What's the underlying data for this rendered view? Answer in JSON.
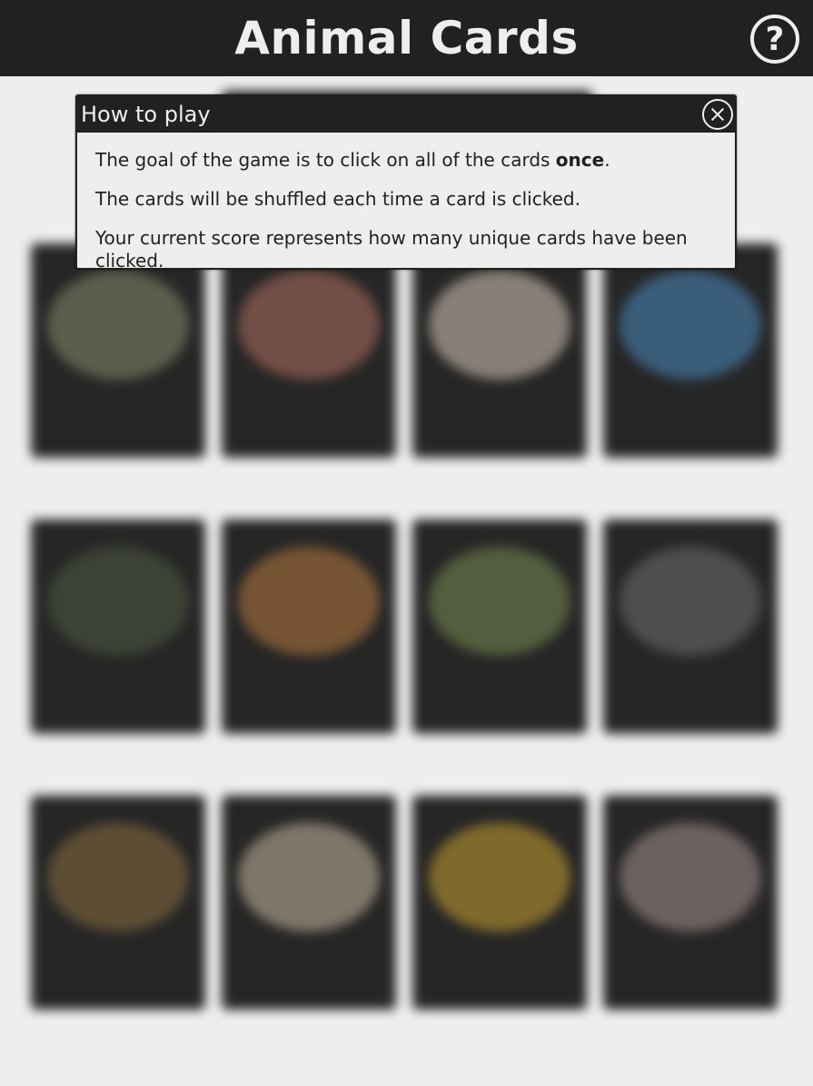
{
  "header": {
    "title": "Animal Cards",
    "help_icon": "question-circle-icon",
    "help_glyph": "?"
  },
  "modal": {
    "title": "How to play",
    "close_icon": "close-circle-icon",
    "line1_before": "The goal of the game is to click on all of the cards ",
    "line1_bold": "once",
    "line1_after": ".",
    "line2": "The cards will be shuffled each time a card is clicked.",
    "line3": "Your current score represents how many unique cards have been clicked."
  },
  "cards": [
    {
      "art_color": "#8a8a6e"
    },
    {
      "art_color": "#b07060"
    },
    {
      "art_color": "#d8c8b8"
    },
    {
      "art_color": "#4a8ac0"
    },
    {
      "art_color": "#4e5a40"
    },
    {
      "art_color": "#b87a40"
    },
    {
      "art_color": "#7a8a50"
    },
    {
      "art_color": "#707070"
    },
    {
      "art_color": "#8a6e40"
    },
    {
      "art_color": "#c8b8a0"
    },
    {
      "art_color": "#c8a030"
    },
    {
      "art_color": "#a89090"
    }
  ],
  "colors": {
    "header_bg": "#212121",
    "page_bg": "#eeeeee",
    "card_bg": "#262626"
  }
}
